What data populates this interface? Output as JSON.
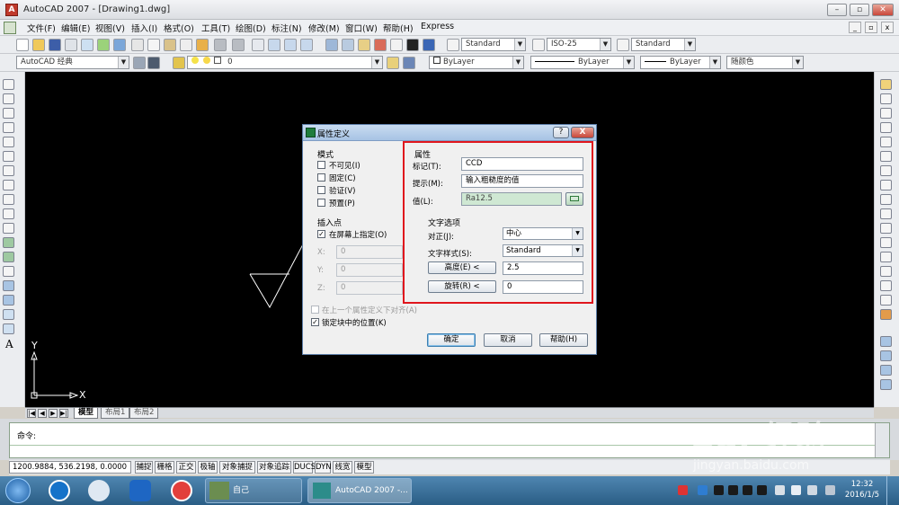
{
  "window": {
    "title": "AutoCAD 2007 - [Drawing1.dwg]"
  },
  "menu": [
    "文件(F)",
    "编辑(E)",
    "视图(V)",
    "插入(I)",
    "格式(O)",
    "工具(T)",
    "绘图(D)",
    "标注(N)",
    "修改(M)",
    "窗口(W)",
    "帮助(H)",
    "Express"
  ],
  "toolbar": {
    "text_style": "Standard",
    "dim_style": "ISO-25",
    "table_style": "Standard",
    "workspace": "AutoCAD 经典",
    "layer": "0",
    "color": "ByLayer",
    "linetype": "ByLayer",
    "lineweight": "ByLayer",
    "plotstyle": "随颜色"
  },
  "canvas": {
    "ucs_x": "X",
    "ucs_y": "Y"
  },
  "tabs": [
    "模型",
    "布局1",
    "布局2"
  ],
  "command": {
    "prompt": "命令:"
  },
  "status": {
    "coords": "1200.9884, 536.2198, 0.0000",
    "buttons": [
      "捕捉",
      "栅格",
      "正交",
      "极轴",
      "对象捕捉",
      "对象追踪",
      "DUCS",
      "DYN",
      "线宽",
      "模型"
    ]
  },
  "taskbar": {
    "tasks": [
      "自己",
      "AutoCAD 2007 -..."
    ],
    "time": "12:32",
    "date": "2016/1/5"
  },
  "dialog": {
    "title": "属性定义",
    "help_glyph": "?",
    "close_glyph": "X",
    "mode": {
      "label": "模式",
      "items": [
        {
          "label": "不可见(I)",
          "checked": false
        },
        {
          "label": "固定(C)",
          "checked": false
        },
        {
          "label": "验证(V)",
          "checked": false
        },
        {
          "label": "预置(P)",
          "checked": false
        }
      ]
    },
    "attribute": {
      "label": "属性",
      "tag_label": "标记(T):",
      "tag_value": "CCD",
      "prompt_label": "提示(M):",
      "prompt_value": "输入粗糙度的值",
      "value_label": "值(L):",
      "value_value": "Ra12.5"
    },
    "insertion": {
      "label": "插入点",
      "specify_label": "在屏幕上指定(O)",
      "specify_checked": true,
      "x_label": "X:",
      "x_value": "0",
      "y_label": "Y:",
      "y_value": "0",
      "z_label": "Z:",
      "z_value": "0"
    },
    "text": {
      "label": "文字选项",
      "justify_label": "对正(J):",
      "justify_value": "中心",
      "style_label": "文字样式(S):",
      "style_value": "Standard",
      "height_button": "高度(E) <",
      "height_value": "2.5",
      "rotation_button": "旋转(R) <",
      "rotation_value": "0"
    },
    "align_below": {
      "label": "在上一个属性定义下对齐(A)",
      "checked": false
    },
    "lock_position": {
      "label": "锁定块中的位置(K)",
      "checked": true
    },
    "buttons": {
      "ok": "确定",
      "cancel": "取消",
      "help": "帮助(H)"
    }
  },
  "watermark": {
    "logo": "Bai  经验",
    "url": "jingyan.baidu.com"
  },
  "colors": {
    "highlight": "#e0161d",
    "canvas": "#000000"
  }
}
